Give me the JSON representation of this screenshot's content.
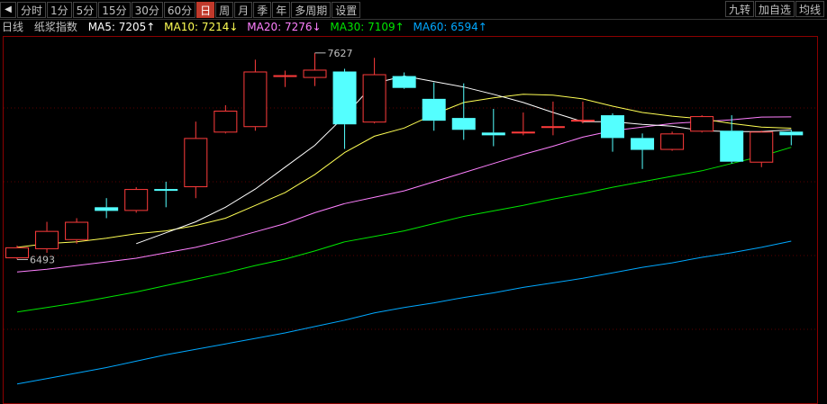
{
  "toolbar": {
    "back_icon": "left-triangle-icon",
    "periods": [
      "分时",
      "1分",
      "5分",
      "15分",
      "30分",
      "60分",
      "日",
      "周",
      "月",
      "季",
      "年",
      "多周期",
      "设置"
    ],
    "active_index": 6,
    "right": [
      "九转",
      "加自选",
      "均线"
    ]
  },
  "legend": {
    "period": "日线",
    "name": "纸浆指数",
    "ma5": "MA5: 7205↑",
    "ma10": "MA10: 7214↓",
    "ma20": "MA20: 7276↓",
    "ma30": "MA30: 7109↑",
    "ma60": "MA60: 6594↑"
  },
  "colors": {
    "up": "#ff3c3c",
    "down": "#54ffff",
    "ma5": "#ffffff",
    "ma10": "#ffff54",
    "ma20": "#ff80ff",
    "ma30": "#00e600",
    "ma60": "#00a8ff"
  },
  "chart_data": {
    "type": "candlestick",
    "high_label": "7627",
    "low_label": "6493",
    "high_value": 7627,
    "low_value": 6493,
    "ylim": [
      5700,
      7720
    ],
    "candles": [
      {
        "o": 6500,
        "c": 6560,
        "h": 6570,
        "l": 6493
      },
      {
        "o": 6550,
        "c": 6650,
        "h": 6700,
        "l": 6530
      },
      {
        "o": 6600,
        "c": 6700,
        "h": 6720,
        "l": 6580
      },
      {
        "o": 6780,
        "c": 6760,
        "h": 6830,
        "l": 6720
      },
      {
        "o": 6760,
        "c": 6880,
        "h": 6890,
        "l": 6750
      },
      {
        "o": 6880,
        "c": 6870,
        "h": 6920,
        "l": 6780
      },
      {
        "o": 6890,
        "c": 7160,
        "h": 7250,
        "l": 6830
      },
      {
        "o": 7190,
        "c": 7310,
        "h": 7340,
        "l": 7185
      },
      {
        "o": 7220,
        "c": 7525,
        "h": 7590,
        "l": 7200
      },
      {
        "o": 7495,
        "c": 7505,
        "h": 7530,
        "l": 7440
      },
      {
        "o": 7490,
        "c": 7535,
        "h": 7627,
        "l": 7445
      },
      {
        "o": 7525,
        "c": 7235,
        "h": 7540,
        "l": 7100
      },
      {
        "o": 7245,
        "c": 7510,
        "h": 7600,
        "l": 7240
      },
      {
        "o": 7500,
        "c": 7435,
        "h": 7520,
        "l": 7430
      },
      {
        "o": 7375,
        "c": 7255,
        "h": 7465,
        "l": 7200
      },
      {
        "o": 7270,
        "c": 7205,
        "h": 7460,
        "l": 7150
      },
      {
        "o": 7190,
        "c": 7175,
        "h": 7320,
        "l": 7115
      },
      {
        "o": 7190,
        "c": 7195,
        "h": 7300,
        "l": 7175
      },
      {
        "o": 7225,
        "c": 7225,
        "h": 7360,
        "l": 7175
      },
      {
        "o": 7255,
        "c": 7260,
        "h": 7360,
        "l": 7240
      },
      {
        "o": 7285,
        "c": 7160,
        "h": 7295,
        "l": 7085
      },
      {
        "o": 7160,
        "c": 7095,
        "h": 7185,
        "l": 6990
      },
      {
        "o": 7095,
        "c": 7185,
        "h": 7195,
        "l": 7090
      },
      {
        "o": 7195,
        "c": 7280,
        "h": 7285,
        "l": 7190
      },
      {
        "o": 7200,
        "c": 7030,
        "h": 7285,
        "l": 7020
      },
      {
        "o": 7025,
        "c": 7195,
        "h": 7200,
        "l": 7000
      },
      {
        "o": 7195,
        "c": 7175,
        "h": 7205,
        "l": 7120
      }
    ],
    "ma5": [
      null,
      null,
      null,
      null,
      6580,
      6640,
      6700,
      6780,
      6880,
      7000,
      7120,
      7280,
      7460,
      7500,
      7470,
      7440,
      7400,
      7355,
      7300,
      7250,
      7250,
      7235,
      7225,
      7200,
      7195,
      7195,
      7205
    ],
    "ma10": [
      6560,
      6580,
      6590,
      6610,
      6635,
      6650,
      6680,
      6720,
      6790,
      6860,
      6960,
      7080,
      7170,
      7215,
      7290,
      7355,
      7380,
      7400,
      7395,
      7375,
      7335,
      7300,
      7280,
      7265,
      7240,
      7220,
      7214
    ],
    "ma20": [
      6425,
      6440,
      6460,
      6480,
      6500,
      6530,
      6560,
      6600,
      6645,
      6690,
      6750,
      6800,
      6835,
      6870,
      6920,
      6970,
      7020,
      7070,
      7115,
      7165,
      7200,
      7220,
      7240,
      7250,
      7260,
      7275,
      7276
    ],
    "ma30": [
      6205,
      6230,
      6255,
      6285,
      6315,
      6350,
      6385,
      6420,
      6460,
      6495,
      6540,
      6590,
      6620,
      6650,
      6690,
      6730,
      6760,
      6790,
      6825,
      6855,
      6890,
      6920,
      6950,
      6980,
      7020,
      7060,
      7109
    ],
    "ma60": [
      5810,
      5840,
      5870,
      5900,
      5935,
      5970,
      6000,
      6030,
      6060,
      6090,
      6125,
      6160,
      6200,
      6230,
      6255,
      6285,
      6310,
      6340,
      6365,
      6390,
      6420,
      6450,
      6475,
      6505,
      6530,
      6560,
      6594
    ]
  }
}
